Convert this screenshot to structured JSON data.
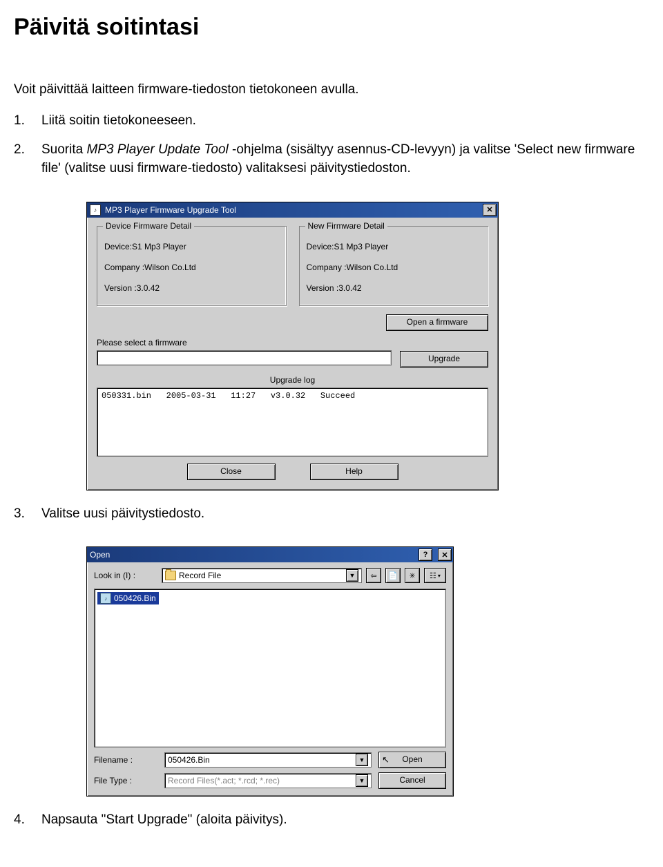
{
  "heading": "Päivitä soitintasi",
  "intro": "Voit päivittää laitteen firmware-tiedoston tietokoneen avulla.",
  "steps": {
    "s1": {
      "num": "1.",
      "text": "Liitä soitin tietokoneeseen."
    },
    "s2": {
      "num": "2.",
      "pre": "Suorita ",
      "italic": "MP3 Player Update Tool",
      "post": " -ohjelma (sisältyy asennus-CD-levyyn) ja valitse 'Select new firmware file' (valitse uusi firmware-tiedosto) valitaksesi päivitystiedoston."
    },
    "s3": {
      "num": "3.",
      "text": "Valitse uusi päivitystiedosto."
    },
    "s4": {
      "num": "4.",
      "text": "Napsauta \"Start Upgrade\" (aloita päivitys)."
    }
  },
  "upgrade_dialog": {
    "title": "MP3 Player Firmware Upgrade Tool",
    "close_x": "✕",
    "group_device": {
      "legend": "Device Firmware Detail",
      "device": "Device:S1 Mp3 Player",
      "company": "Company :Wilson Co.Ltd",
      "version": "Version :3.0.42"
    },
    "group_new": {
      "legend": "New Firmware Detail",
      "device": "Device:S1 Mp3 Player",
      "company": "Company :Wilson Co.Ltd",
      "version": "Version :3.0.42"
    },
    "open_fw_btn": "Open a firmware",
    "please_select": "Please select a firmware",
    "path_value": "",
    "upgrade_btn": "Upgrade",
    "log_label": "Upgrade log",
    "log_line": "050331.bin   2005-03-31   11:27   v3.0.32   Succeed",
    "close_btn": "Close",
    "help_btn": "Help"
  },
  "open_dialog": {
    "title": "Open",
    "help_q": "?",
    "close_x": "✕",
    "lookin_label": "Look in  (I) :",
    "folder_name": "Record File",
    "tb_back": "⇦",
    "tb_up": "📄",
    "tb_new": "✳",
    "tb_view": "☷",
    "selected_file": "050426.Bin",
    "filename_label": "Filename :",
    "filename_value": "050426.Bin",
    "filetype_label": "File Type :",
    "filetype_value": "Record Files(*.act; *.rcd; *.rec)",
    "open_btn": "Open",
    "cancel_btn": "Cancel",
    "cursor": "↖"
  }
}
